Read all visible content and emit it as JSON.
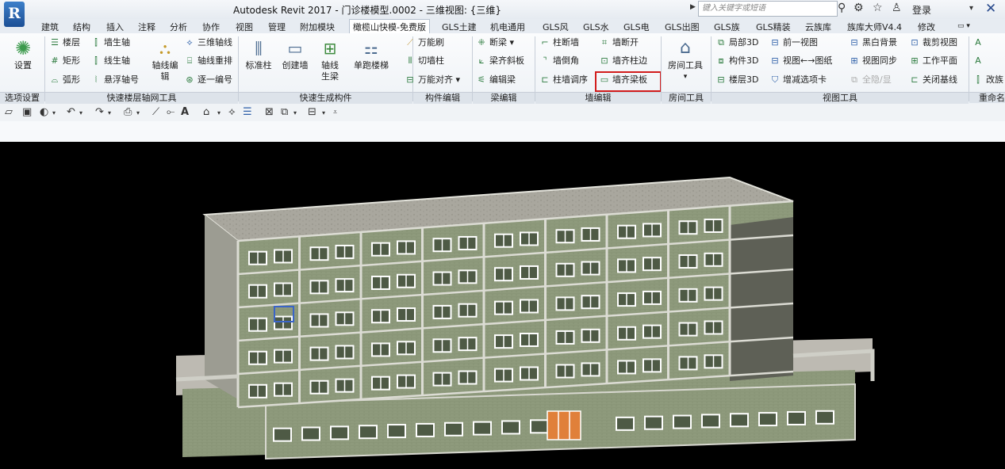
{
  "app": {
    "logo": "R",
    "title": "Autodesk Revit 2017 -     门诊楼模型.0002 - 三维视图: {三维}",
    "search_placeholder": "键入关键字或短语",
    "login": "登录"
  },
  "tabs": [
    "建筑",
    "结构",
    "插入",
    "注释",
    "分析",
    "协作",
    "视图",
    "管理",
    "附加模块",
    "橄榄山快模-免费版",
    "GLS土建",
    "机电通用",
    "GLS风",
    "GLS水",
    "GLS电",
    "GLS出图",
    "GLS族",
    "GLS精装",
    "云族库",
    "族库大师V4.4",
    "修改"
  ],
  "active_tab": "橄榄山快模-免费版",
  "ribbon": {
    "settings": {
      "label": "设置",
      "panel": "选项设置"
    },
    "grid_panel": {
      "label": "快速楼层轴网工具",
      "items": [
        "楼层",
        "墙生轴",
        "矩形",
        "线生轴",
        "弧形",
        "悬浮轴号",
        "轴线编辑",
        "三维轴线",
        "轴线重排",
        "逐一编号"
      ]
    },
    "component_panel": {
      "label": "快速生成构件",
      "items": [
        "标准柱",
        "创建墙",
        "轴线生梁",
        "单跑楼梯"
      ]
    },
    "element_edit": {
      "label": "构件编辑",
      "items": [
        "万能刷",
        "切墙柱",
        "万能对齐"
      ]
    },
    "beam_edit": {
      "label": "梁编辑",
      "items": [
        "断梁",
        "梁齐斜板",
        "编辑梁"
      ]
    },
    "wall_edit": {
      "label": "墙编辑",
      "items": [
        "柱断墙",
        "墙断开",
        "墙倒角",
        "墙齐柱边",
        "柱墙调序",
        "墙齐梁板"
      ],
      "highlighted": "墙齐梁板"
    },
    "room_tools": {
      "label": "房间工具",
      "items": [
        "房间工具"
      ]
    },
    "view_tools": {
      "label": "视图工具",
      "items": [
        "局部3D",
        "前一视图",
        "黑白背景",
        "裁剪视图",
        "构件3D",
        "视图←→图纸",
        "视图同步",
        "工作平面",
        "楼层3D",
        "增减选项卡",
        "全隐/显",
        "关闭基线"
      ]
    },
    "rename": {
      "label": "重命名",
      "items": [
        "改族"
      ]
    }
  },
  "colors": {
    "highlight": "#d21c1c",
    "viewport_bg": "#000000",
    "wall": "#8e9a7c",
    "window_frame": "#ffffff",
    "door": "#e0803a",
    "selected_window": "#3a64c8"
  }
}
